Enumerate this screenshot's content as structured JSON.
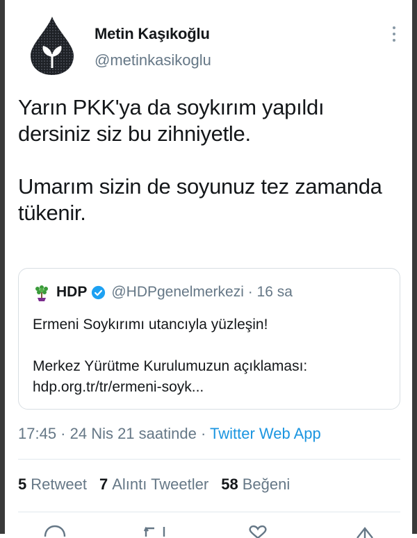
{
  "tweet": {
    "author_name": "Metin Kaşıkoğlu",
    "author_handle": "@metinkasikoglu",
    "text_line1": "Yarın PKK'ya da soykırım yapıldı dersiniz siz bu zihniyetle.",
    "text_line2": "Umarım sizin de soyunuz tez zamanda tükenir."
  },
  "quote": {
    "name": "HDP",
    "meta": "@HDPgenelmerkezi · 16 sa",
    "line1": "Ermeni Soykırımı utancıyla yüzleşin!",
    "line2": "Merkez Yürütme Kurulumuzun açıklaması:",
    "line3": "hdp.org.tr/tr/ermeni-soyk..."
  },
  "timestamp": {
    "time": "17:45 · 24 Nis 21 saatinde · ",
    "source": "Twitter Web App"
  },
  "stats": {
    "retweets": "5",
    "retweets_label": "Retweet",
    "quotes": "7",
    "quotes_label": "Alıntı Tweetler",
    "likes": "58",
    "likes_label": "Beğeni"
  },
  "colors": {
    "link": "#1b95e0",
    "muted": "#657786",
    "verified": "#1da1f2"
  },
  "icons": [
    "more-vertical-icon",
    "verified-badge-icon",
    "reply-icon",
    "retweet-icon",
    "like-icon",
    "share-icon"
  ]
}
